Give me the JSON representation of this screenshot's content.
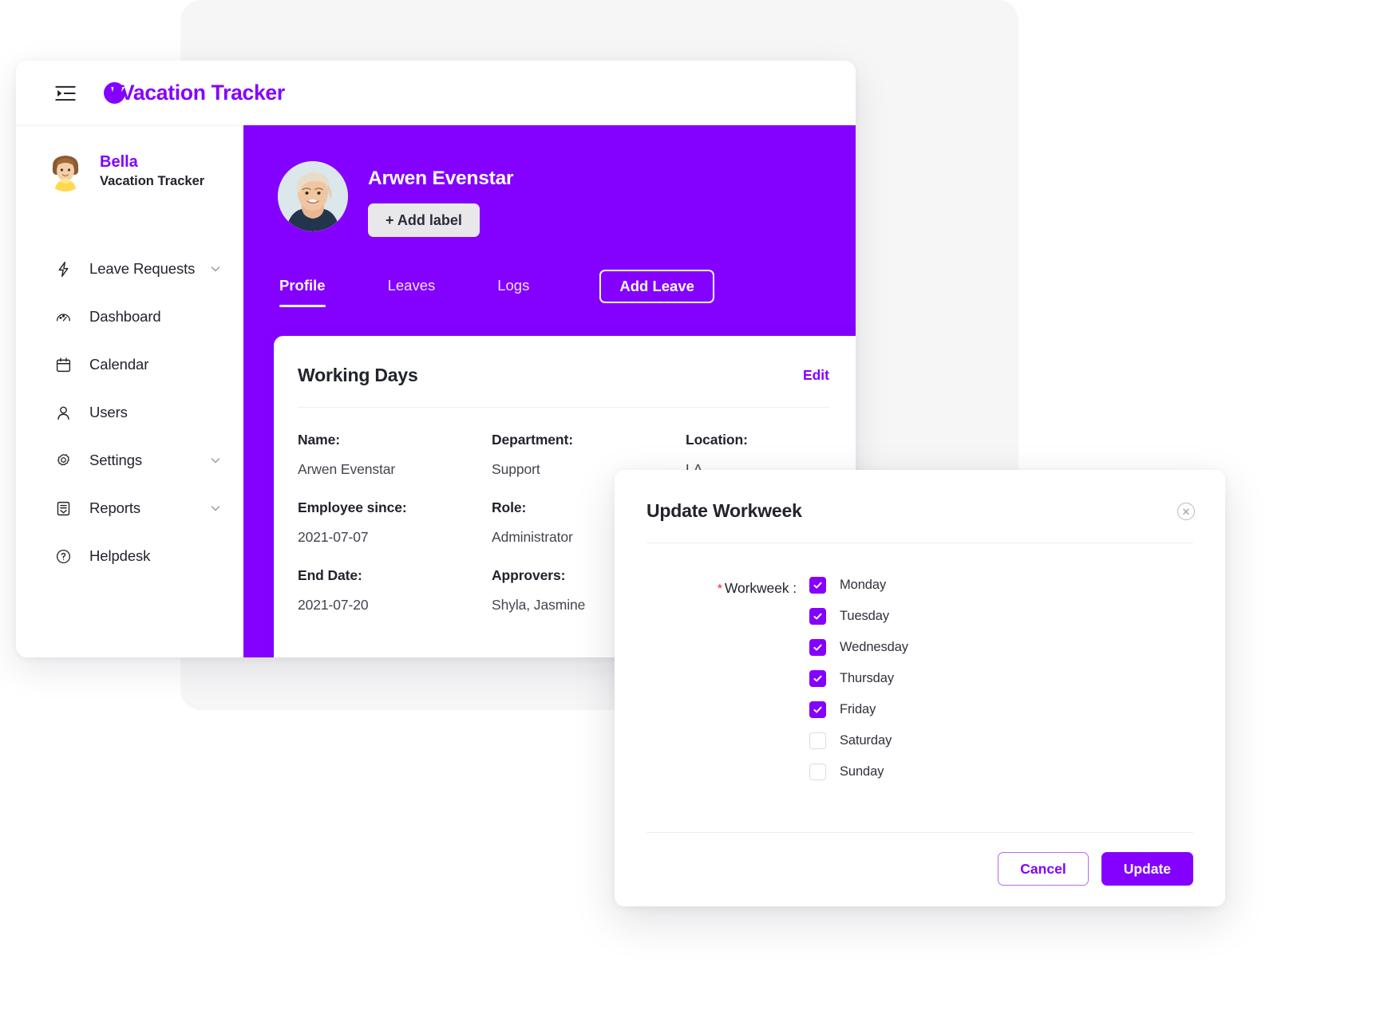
{
  "brand": {
    "name": "Vacation Tracker",
    "logo_icon": "v-circle-logo-icon",
    "collapse_icon": "collapse-sidebar-icon",
    "accent_color": "#8400ff"
  },
  "sidebar": {
    "user": {
      "name": "Bella",
      "org": "Vacation Tracker",
      "avatar_icon": "user-avatar"
    },
    "items": [
      {
        "label": "Leave Requests",
        "icon": "bolt-icon",
        "has_caret": true
      },
      {
        "label": "Dashboard",
        "icon": "gauge-icon",
        "has_caret": false
      },
      {
        "label": "Calendar",
        "icon": "calendar-icon",
        "has_caret": false
      },
      {
        "label": "Users",
        "icon": "person-icon",
        "has_caret": false
      },
      {
        "label": "Settings",
        "icon": "gear-icon",
        "has_caret": true
      },
      {
        "label": "Reports",
        "icon": "report-icon",
        "has_caret": true
      },
      {
        "label": "Helpdesk",
        "icon": "question-circle-icon",
        "has_caret": false
      }
    ]
  },
  "profile": {
    "name": "Arwen Evenstar",
    "add_label_button": "+ Add label",
    "photo_icon": "profile-photo"
  },
  "tabs": [
    {
      "label": "Profile",
      "active": true
    },
    {
      "label": "Leaves",
      "active": false
    },
    {
      "label": "Logs",
      "active": false
    }
  ],
  "add_leave_button": "Add Leave",
  "card": {
    "title": "Working Days",
    "edit_label": "Edit",
    "fields": [
      {
        "label": "Name:",
        "value": "Arwen Evenstar"
      },
      {
        "label": "Department:",
        "value": "Support"
      },
      {
        "label": "Location:",
        "value": "LA"
      },
      {
        "label": "Employee since:",
        "value": "2021-07-07"
      },
      {
        "label": "Role:",
        "value": "Administrator"
      },
      {
        "label": "",
        "value": ""
      },
      {
        "label": "End Date:",
        "value": "2021-07-20"
      },
      {
        "label": "Approvers:",
        "value": "Shyla, Jasmine"
      },
      {
        "label": "",
        "value": ""
      }
    ]
  },
  "modal": {
    "title": "Update Workweek",
    "close_icon": "close-icon",
    "required_marker": "*",
    "field_label": "Workweek :",
    "days": [
      {
        "name": "Monday",
        "checked": true
      },
      {
        "name": "Tuesday",
        "checked": true
      },
      {
        "name": "Wednesday",
        "checked": true
      },
      {
        "name": "Thursday",
        "checked": true
      },
      {
        "name": "Friday",
        "checked": true
      },
      {
        "name": "Saturday",
        "checked": false
      },
      {
        "name": "Sunday",
        "checked": false
      }
    ],
    "cancel_label": "Cancel",
    "update_label": "Update"
  }
}
